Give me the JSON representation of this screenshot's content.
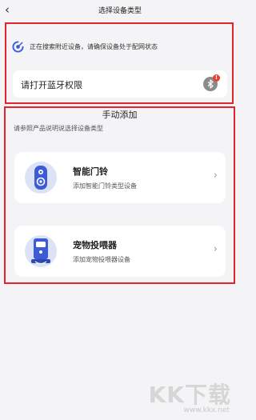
{
  "header": {
    "back_glyph": "‹",
    "title": "选择设备类型"
  },
  "scan": {
    "message": "正在搜索附近设备，请确保设备处于配网状态"
  },
  "bluetooth": {
    "label": "请打开蓝牙权限",
    "badge": "!"
  },
  "manual": {
    "title": "手动添加",
    "hint": "请参照产品说明说选择设备类型",
    "devices": [
      {
        "name": "智能门铃",
        "desc": "添加智能门铃类型设备",
        "icon": "doorbell-icon"
      },
      {
        "name": "宠物投喂器",
        "desc": "添加宠物投喂器设备",
        "icon": "pet-feeder-icon"
      }
    ]
  },
  "watermark": {
    "brand": "KK下载",
    "url": "www.kkx.net"
  },
  "colors": {
    "accent": "#3d5bd6",
    "highlight_border": "#e3232f",
    "background": "#f4f4f6"
  }
}
